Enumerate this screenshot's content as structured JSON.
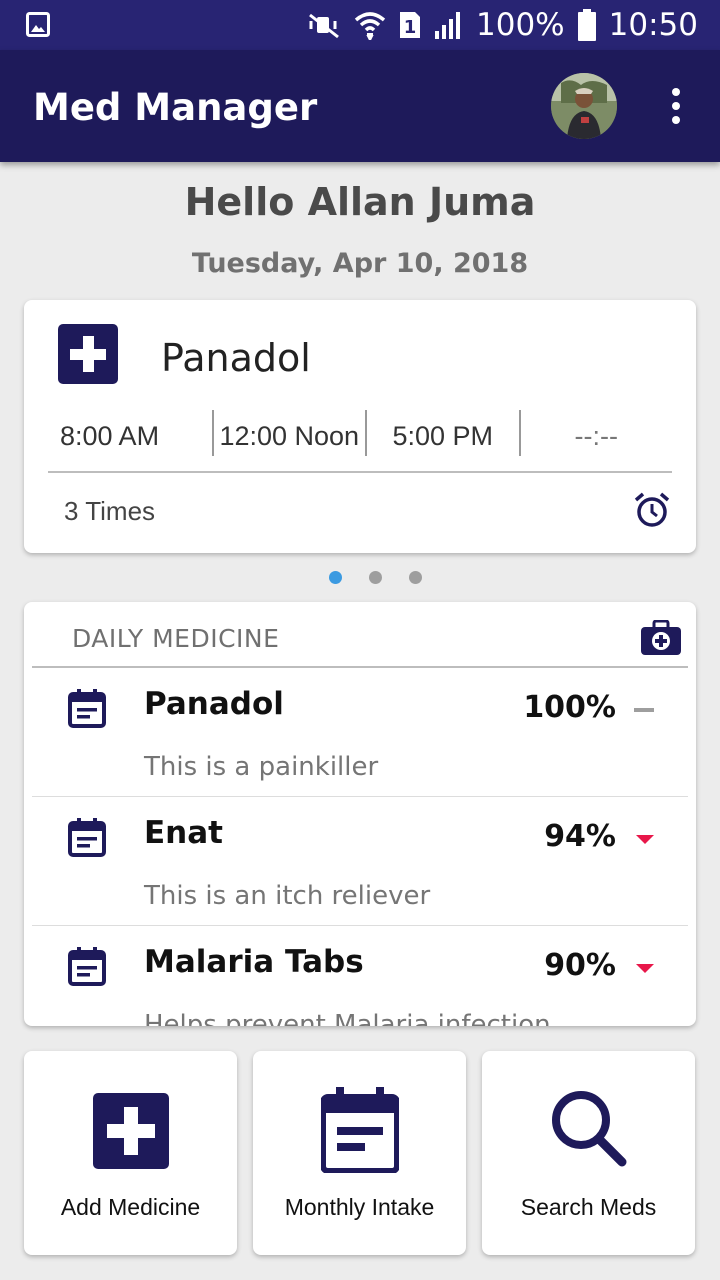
{
  "status_bar": {
    "battery": "100%",
    "time": "10:50",
    "sim_slot": "1",
    "icons": [
      "gallery-icon",
      "mute-icon",
      "wifi-icon",
      "sim-icon",
      "signal-icon",
      "battery-icon"
    ]
  },
  "app_bar": {
    "title": "Med Manager",
    "icons": [
      "avatar",
      "more-vert-icon"
    ]
  },
  "greeting": "Hello Allan Juma",
  "date": "Tuesday, Apr 10, 2018",
  "schedule_card": {
    "medicine": "Panadol",
    "times": [
      "8:00 AM",
      "12:00 Noon",
      "5:00 PM",
      "--:--"
    ],
    "times_count": "3 Times",
    "icon": "alarm-icon"
  },
  "pager": {
    "count": 3,
    "active_index": 0
  },
  "daily_medicine": {
    "header": "DAILY MEDICINE",
    "items": [
      {
        "name": "Panadol",
        "percent": "100%",
        "trend": "flat",
        "description": "This is a painkiller"
      },
      {
        "name": "Enat",
        "percent": "94%",
        "trend": "down",
        "description": "This is an itch reliever"
      },
      {
        "name": "Malaria Tabs",
        "percent": "90%",
        "trend": "down",
        "description": "Helps prevent Malaria infection"
      }
    ]
  },
  "actions": [
    {
      "label": "Add Medicine",
      "icon": "add-medicine-icon"
    },
    {
      "label": "Monthly Intake",
      "icon": "calendar-icon"
    },
    {
      "label": "Search Meds",
      "icon": "search-icon"
    }
  ],
  "colors": {
    "status_bar": "#282473",
    "app_bar": "#1e1a5a",
    "accent": "#1e1a5a",
    "trend_down": "#e8174a",
    "pager_active": "#3b9ae1",
    "background": "#ececec"
  }
}
